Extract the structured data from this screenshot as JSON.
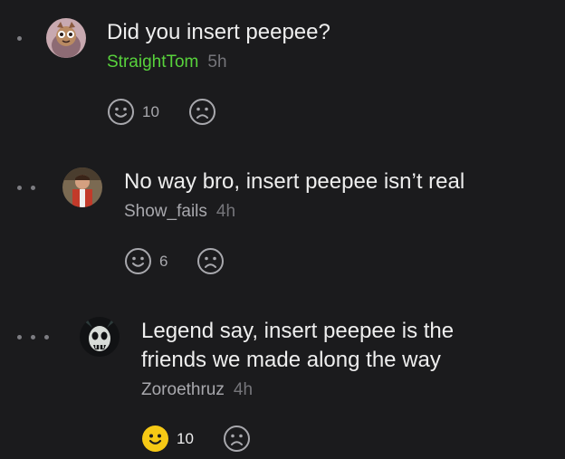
{
  "comments": [
    {
      "text": "Did you insert peepee?",
      "author": "StraightTom",
      "time": "5h",
      "likes": "10",
      "depth": 1,
      "is_op": true,
      "liked": false
    },
    {
      "text": "No way bro, insert peepee isn’t real",
      "author": "Show_fails",
      "time": "4h",
      "likes": "6",
      "depth": 2,
      "is_op": false,
      "liked": false
    },
    {
      "text": "Legend say, insert peepee is the friends we made along the way",
      "author": "Zoroethruz",
      "time": "4h",
      "likes": "10",
      "depth": 3,
      "is_op": false,
      "liked": true
    }
  ],
  "icons": {
    "upvote": "happy-face-icon",
    "downvote": "sad-face-icon",
    "thread_depth": "thread-depth-dot-icon"
  },
  "colors": {
    "background": "#1b1b1d",
    "op_author": "#58d23c",
    "author": "#a8a8ad",
    "active_upvote": "#f6c915"
  }
}
